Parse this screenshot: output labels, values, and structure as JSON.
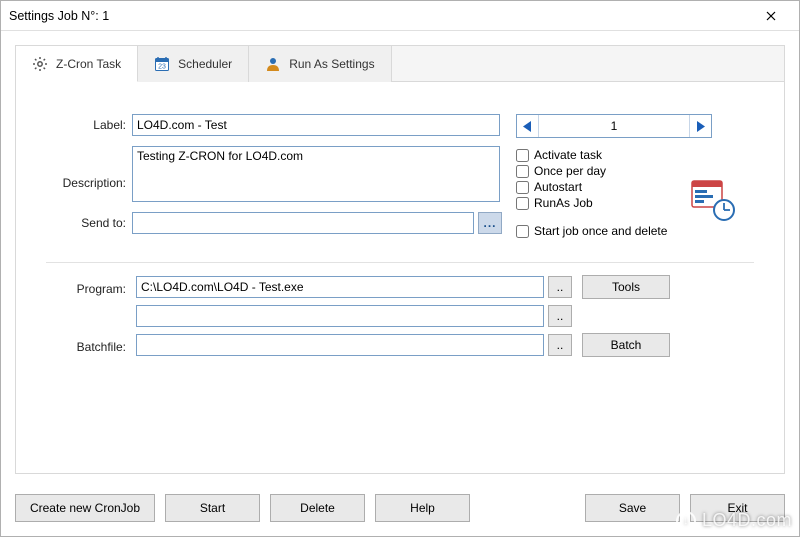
{
  "window": {
    "title": "Settings Job N°: 1"
  },
  "tabs": {
    "task": "Z-Cron Task",
    "scheduler": "Scheduler",
    "runas": "Run As Settings"
  },
  "form": {
    "labels": {
      "label": "Label:",
      "description": "Description:",
      "sendto": "Send to:",
      "program": "Program:",
      "batchfile": "Batchfile:"
    },
    "values": {
      "label": "LO4D.com - Test",
      "description": "Testing Z-CRON for LO4D.com",
      "sendto": "",
      "program": "C:\\LO4D.com\\LO4D - Test.exe",
      "program2": "",
      "batchfile": ""
    },
    "browse": ".."
  },
  "spinner": {
    "value": "1"
  },
  "checks": {
    "activate": "Activate task",
    "onceperday": "Once per day",
    "autostart": "Autostart",
    "runasjob": "RunAs Job",
    "startonce": "Start job once and delete"
  },
  "buttons": {
    "tools": "Tools",
    "batch": "Batch",
    "create": "Create new CronJob",
    "start": "Start",
    "delete": "Delete",
    "help": "Help",
    "save": "Save",
    "exit": "Exit"
  },
  "watermark": "LO4D.com"
}
